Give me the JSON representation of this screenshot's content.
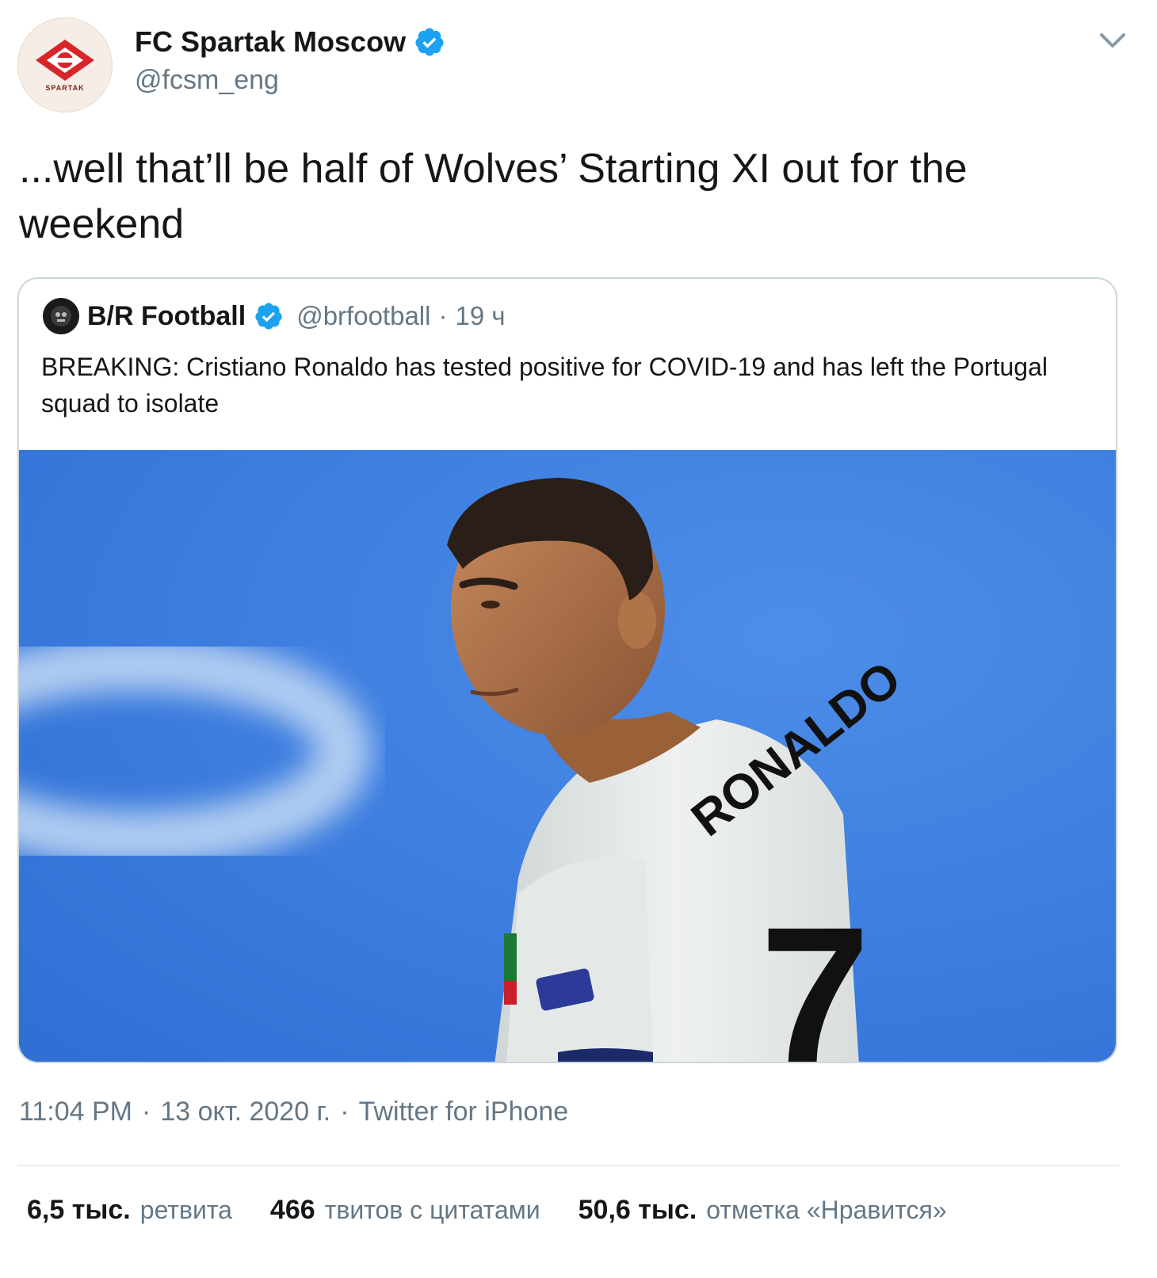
{
  "author": {
    "display_name": "FC Spartak Moscow",
    "handle": "@fcsm_eng",
    "verified": true,
    "avatar_icon": "spartak-logo-icon",
    "avatar_text": "SPARTAK"
  },
  "tweet": {
    "text": "...well that’ll be half of Wolves’ Starting XI out for the weekend"
  },
  "quote": {
    "display_name": "B/R Football",
    "handle": "@brfootball",
    "separator": "·",
    "time": "19 ч",
    "text": "BREAKING: Cristiano Ronaldo has tested positive for COVID-19 and has left the Portugal squad to isolate",
    "media_icon": "ronaldo-photo",
    "jersey_name": "RONALDO",
    "jersey_number": "7"
  },
  "meta": {
    "time": "11:04 PM",
    "sep1": "·",
    "date": "13 окт. 2020 г.",
    "sep2": "·",
    "source": "Twitter for iPhone"
  },
  "stats": {
    "retweets_num": "6,5 тыс.",
    "retweets_label": "ретвита",
    "quotes_num": "466",
    "quotes_label": "твитов с цитатами",
    "likes_num": "50,6 тыс.",
    "likes_label": "отметка «Нравится»"
  },
  "colors": {
    "accent": "#1da1f2",
    "secondary_text": "#657786",
    "border": "#ccd6dd"
  }
}
